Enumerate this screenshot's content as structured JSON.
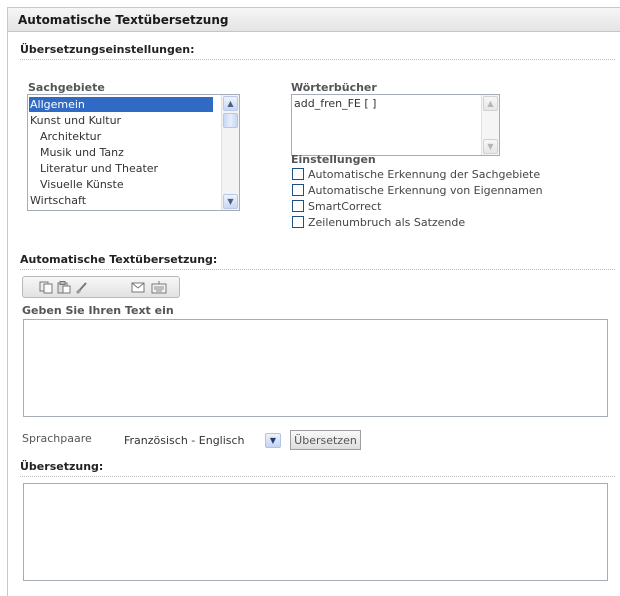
{
  "window": {
    "title": "Automatische Textübersetzung"
  },
  "settings": {
    "heading": "Übersetzungseinstellungen:",
    "subjects": {
      "label": "Sachgebiete",
      "items": [
        {
          "label": "Allgemein",
          "selected": true
        },
        {
          "label": "Kunst und Kultur"
        },
        {
          "label": "Architektur"
        },
        {
          "label": "Musik und Tanz"
        },
        {
          "label": "Literatur und Theater"
        },
        {
          "label": "Visuelle Künste"
        },
        {
          "label": "Wirtschaft"
        }
      ]
    },
    "dictionaries": {
      "label": "Wörterbücher",
      "items": [
        {
          "label": "add_fren_FE [ ]"
        }
      ]
    },
    "options": {
      "label": "Einstellungen",
      "items": [
        {
          "label": "Automatische Erkennung der Sachgebiete",
          "checked": false
        },
        {
          "label": "Automatische Erkennung von Eigennamen",
          "checked": false
        },
        {
          "label": "SmartCorrect",
          "checked": false
        },
        {
          "label": "Zeilenumbruch als Satzende",
          "checked": false
        }
      ]
    }
  },
  "translation_input": {
    "heading": "Automatische Textübersetzung:",
    "toolbar_icons": [
      "copy-icon",
      "paste-icon",
      "clear-icon",
      "email-icon",
      "keyboard-icon"
    ],
    "label": "Geben Sie Ihren Text ein",
    "value": ""
  },
  "language": {
    "label": "Sprachpaare",
    "selected": "Französisch - Englisch",
    "translate_button": "Übersetzen"
  },
  "result": {
    "heading": "Übersetzung:",
    "value": ""
  },
  "colors": {
    "selection": "#316ac5",
    "checkbox_border": "#1c5180"
  }
}
